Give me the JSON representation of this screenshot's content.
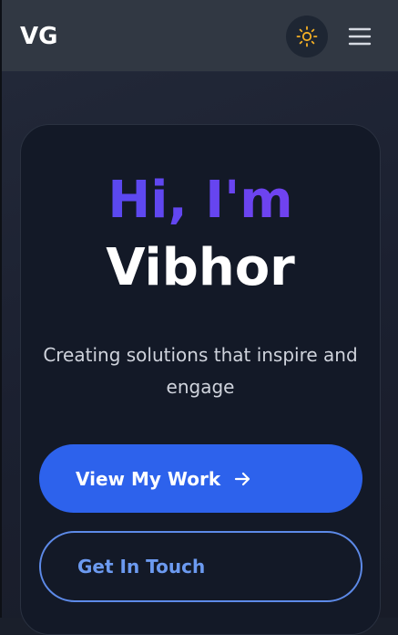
{
  "header": {
    "logo": "VG",
    "theme_toggle_icon": "sun-icon",
    "menu_icon": "hamburger-menu-icon"
  },
  "hero": {
    "greeting": "Hi, I'm",
    "name": "Vibhor",
    "tagline": "Creating solutions that inspire and engage",
    "primary_button": "View My Work",
    "primary_button_icon": "arrow-right-icon",
    "secondary_button": "Get In Touch"
  },
  "colors": {
    "accent_blue": "#2d62ec",
    "gradient_start": "#4f4cf0",
    "gradient_end": "#7b3ff0",
    "sun_icon": "#f5b025",
    "outline_button": "#5d8ae8"
  }
}
